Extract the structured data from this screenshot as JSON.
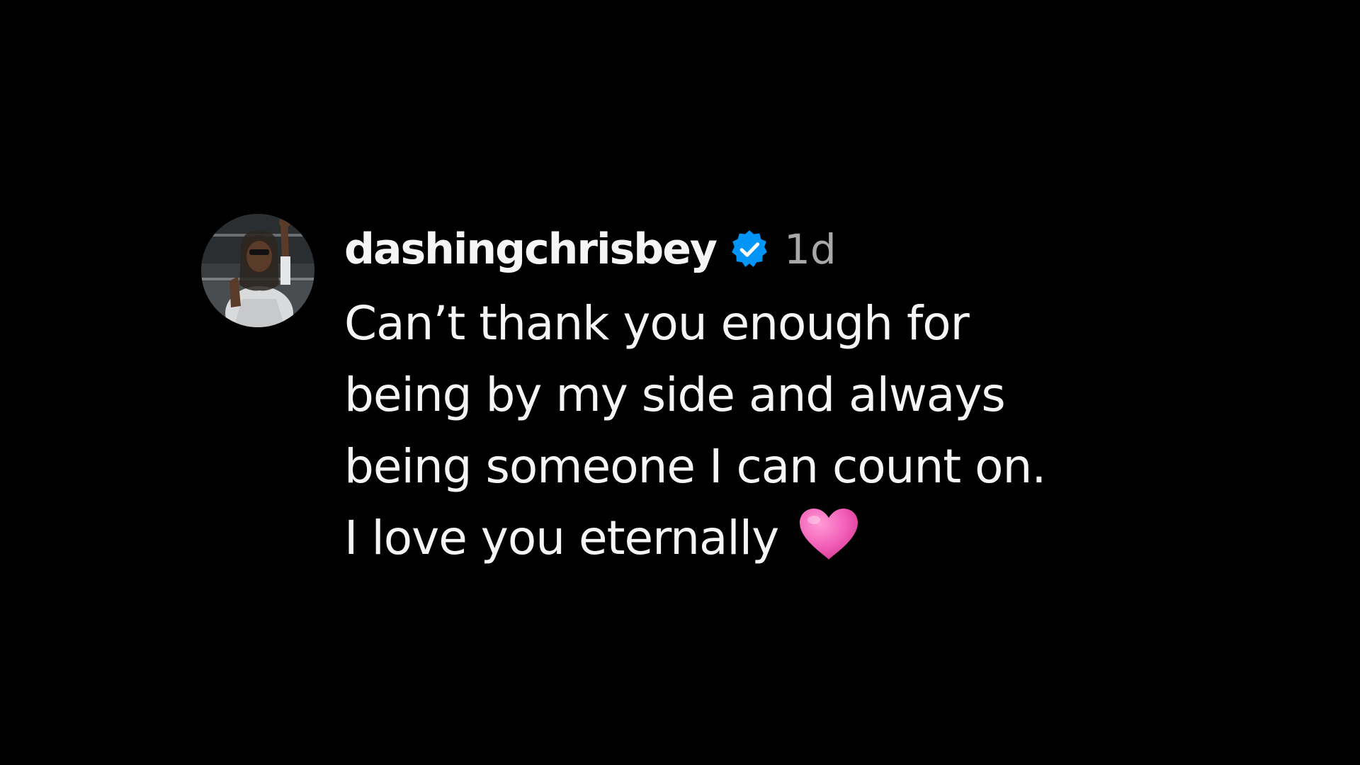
{
  "comment": {
    "username": "dashingchrisbey",
    "verified_icon": "verified-badge-icon",
    "timestamp": "1d",
    "text_lines": [
      "Can’t thank you enough for",
      "being by my side and always",
      "being someone I can count on.",
      "I love you eternally"
    ],
    "emoji": "pink-heart-icon"
  },
  "colors": {
    "background": "#000000",
    "text": "#f5f5f5",
    "timestamp": "#a8a8a8",
    "verified_blue": "#0095f6",
    "heart_pink": "#f25fb8"
  }
}
